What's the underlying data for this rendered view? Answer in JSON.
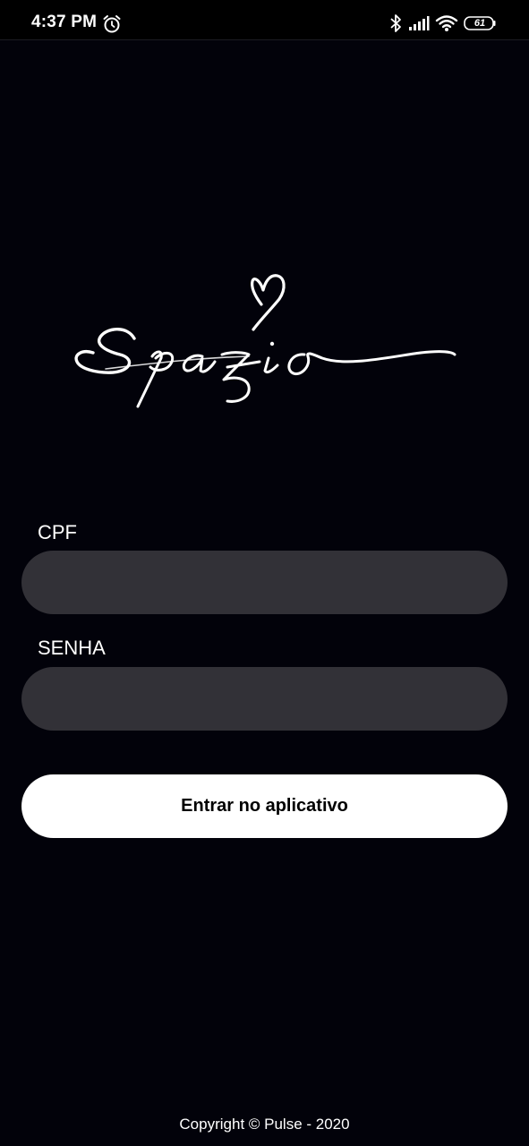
{
  "status_bar": {
    "time": "4:37 PM",
    "battery": "61",
    "icons": [
      "alarm-icon",
      "bluetooth-icon",
      "signal-icon",
      "wifi-icon",
      "battery-icon"
    ]
  },
  "brand": {
    "logo_text": "Spazio"
  },
  "form": {
    "cpf_label": "CPF",
    "cpf_value": "",
    "senha_label": "SENHA",
    "senha_value": "",
    "submit_label": "Entrar no aplicativo"
  },
  "footer": {
    "copyright": "Copyright © Pulse - 2020"
  },
  "colors": {
    "background": "#02020a",
    "input_background": "#323137",
    "button_background": "#ffffff",
    "button_text": "#000000",
    "text": "#ffffff"
  }
}
